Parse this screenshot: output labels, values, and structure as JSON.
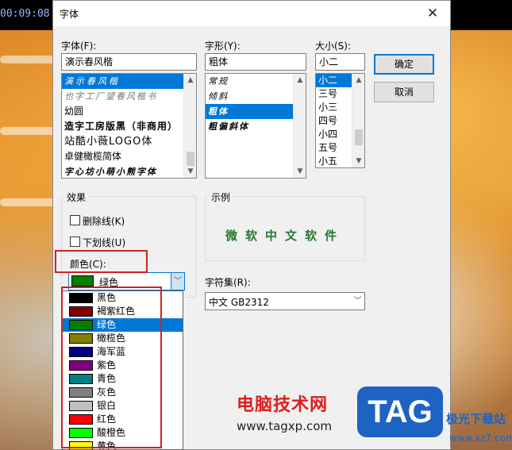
{
  "video": {
    "timecode": "00:09:08"
  },
  "dialog": {
    "title": "字体",
    "close_glyph": "✕",
    "font": {
      "label": "字体(F):",
      "value": "演示春风楷",
      "items": [
        {
          "text": "演示春风楷",
          "selected": true
        },
        {
          "text": "也字工厂望春风楷书",
          "selected": false
        },
        {
          "text": "幼圆",
          "selected": false
        },
        {
          "text": "造字工房版黑（非商用）",
          "selected": false
        },
        {
          "text": "站酷小薇LOGO体",
          "selected": false
        },
        {
          "text": "卓健橄榄简体",
          "selected": false
        },
        {
          "text": "字心坊小萌小熊字体",
          "selected": false
        }
      ]
    },
    "style": {
      "label": "字形(Y):",
      "value": "粗体",
      "items": [
        {
          "text": "常规",
          "selected": false
        },
        {
          "text": "倾斜",
          "selected": false
        },
        {
          "text": "粗体",
          "selected": true
        },
        {
          "text": "粗偏斜体",
          "selected": false
        }
      ]
    },
    "size": {
      "label": "大小(S):",
      "value": "小二",
      "items": [
        {
          "text": "小二",
          "selected": true
        },
        {
          "text": "三号",
          "selected": false
        },
        {
          "text": "小三",
          "selected": false
        },
        {
          "text": "四号",
          "selected": false
        },
        {
          "text": "小四",
          "selected": false
        },
        {
          "text": "五号",
          "selected": false
        },
        {
          "text": "小五",
          "selected": false
        }
      ]
    },
    "buttons": {
      "ok": "确定",
      "cancel": "取消"
    },
    "effects": {
      "title": "效果",
      "strikeout": "删除线(K)",
      "underline": "下划线(U)",
      "color_label": "颜色(C):",
      "color_value": "绿色",
      "color_hex": "#008000"
    },
    "sample": {
      "title": "示例",
      "text": "微软中文软件"
    },
    "charset": {
      "label": "字符集(R):",
      "value": "中文 GB2312"
    },
    "color_options": [
      {
        "name": "黑色",
        "hex": "#000000",
        "selected": false
      },
      {
        "name": "褐紫红色",
        "hex": "#800000",
        "selected": false
      },
      {
        "name": "绿色",
        "hex": "#008000",
        "selected": true
      },
      {
        "name": "橄榄色",
        "hex": "#808000",
        "selected": false
      },
      {
        "name": "海军蓝",
        "hex": "#000080",
        "selected": false
      },
      {
        "name": "紫色",
        "hex": "#800080",
        "selected": false
      },
      {
        "name": "青色",
        "hex": "#008080",
        "selected": false
      },
      {
        "name": "灰色",
        "hex": "#808080",
        "selected": false
      },
      {
        "name": "银白",
        "hex": "#c0c0c0",
        "selected": false
      },
      {
        "name": "红色",
        "hex": "#ff0000",
        "selected": false
      },
      {
        "name": "酸橙色",
        "hex": "#00ff00",
        "selected": false
      },
      {
        "name": "黄色",
        "hex": "#ffff00",
        "selected": false
      }
    ]
  },
  "watermark": {
    "site_name": "电脑技术网",
    "site_url": "www.tagxp.com",
    "logo_text": "TAG",
    "logo_sub": "极光下载站",
    "logo_url": "www.xz7.com"
  }
}
